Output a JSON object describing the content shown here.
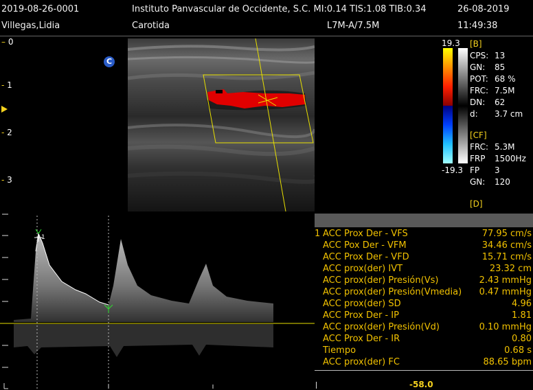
{
  "header": {
    "exam_id": "2019-08-26-0001",
    "institution": "Instituto Panvascular de Occidente, S.C. MI:0.14  TIS:1.08  TIB:0.34",
    "date": "26-08-2019",
    "patient": "Villegas,Lidia",
    "study": "Carotida",
    "probe": "L7M-A/7.5M",
    "time": "11:49:38"
  },
  "depth_scale": [
    "0",
    "1",
    "2",
    "3"
  ],
  "color_marker": "C",
  "color_bar": {
    "max": "19.3",
    "min": "-19.3"
  },
  "b_mode": {
    "title": "[B]",
    "rows": [
      {
        "k": "CPS:",
        "v": "13"
      },
      {
        "k": "GN:",
        "v": "85"
      },
      {
        "k": "POT:",
        "v": "68 %"
      },
      {
        "k": "FRC:",
        "v": "7.5M"
      },
      {
        "k": "DN:",
        "v": "62"
      },
      {
        "k": "d:",
        "v": "3.7 cm"
      }
    ]
  },
  "cf_mode": {
    "title": "[CF]",
    "rows": [
      {
        "k": "FRC:",
        "v": "5.3M"
      },
      {
        "k": "FRP",
        "v": "1500Hz"
      },
      {
        "k": "FP",
        "v": "3"
      },
      {
        "k": "GN:",
        "v": "120"
      }
    ]
  },
  "d_mode": {
    "title": "[D]"
  },
  "cursor_label": "1",
  "measurements": {
    "index": "1",
    "rows": [
      {
        "label": "ACC Prox Der - VFS",
        "value": "77.95 cm/s"
      },
      {
        "label": "ACC Pox Der - VFM",
        "value": "34.46 cm/s"
      },
      {
        "label": "ACC Prox Der - VFD",
        "value": "15.71 cm/s"
      },
      {
        "label": "ACC prox(der) IVT",
        "value": "23.32 cm"
      },
      {
        "label": "ACC prox(der) Presión(Vs)",
        "value": "2.43 mmHg"
      },
      {
        "label": "ACC prox(der) Presión(Vmedia)",
        "value": "0.47 mmHg"
      },
      {
        "label": "ACC prox(der) SD",
        "value": "4.96"
      },
      {
        "label": "ACC Prox Der - IP",
        "value": "1.81"
      },
      {
        "label": "ACC prox(der) Presión(Vd)",
        "value": "0.10 mmHg"
      },
      {
        "label": "ACC Prox Der - IR",
        "value": "0.80"
      },
      {
        "label": "Tiempo",
        "value": "0.68 s"
      },
      {
        "label": "ACC prox(der) FC",
        "value": "88.65 bpm"
      }
    ]
  },
  "velocity_readout": "-58.0",
  "colors": {
    "accent": "#f2c200",
    "flow": "#e00000",
    "guide": "#e8e000"
  }
}
